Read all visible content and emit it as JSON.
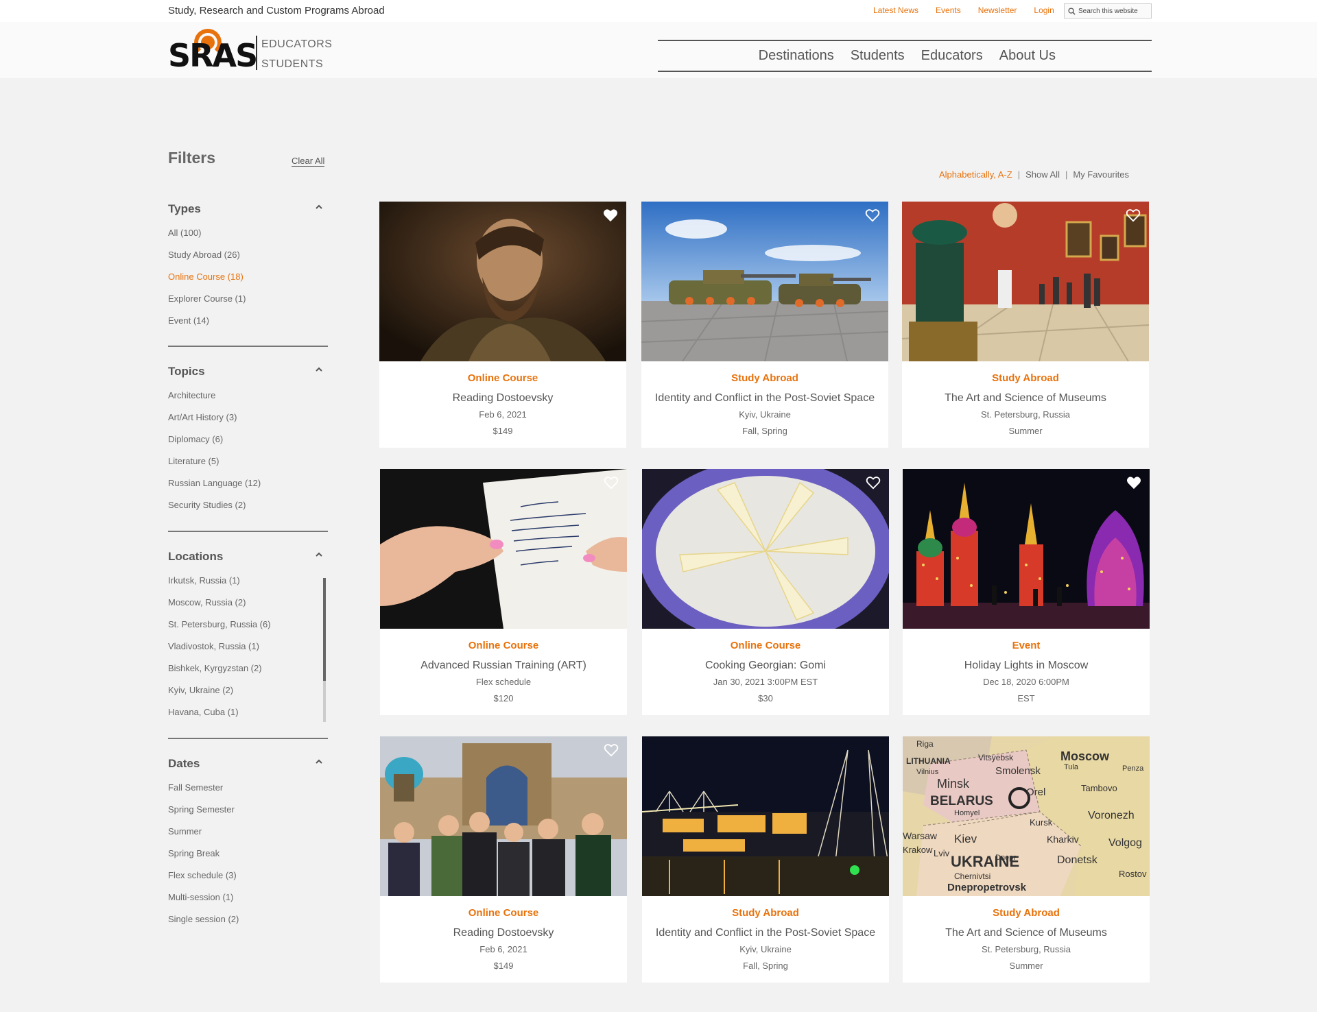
{
  "topbar": {
    "tagline": "Study, Research and Custom Programs Abroad",
    "links": [
      "Latest News",
      "Events",
      "Newsletter",
      "Login"
    ],
    "search_placeholder": "Search this website"
  },
  "header": {
    "logo_text": "SRAS",
    "logo_sub1": "EDUCATORS",
    "logo_sub2": "STUDENTS",
    "nav": [
      "Destinations",
      "Students",
      "Educators",
      "About Us"
    ]
  },
  "filters": {
    "title": "Filters",
    "clear_all": "Clear All",
    "types": {
      "title": "Types",
      "items": [
        "All (100)",
        "Study Abroad (26)",
        "Online Course (18)",
        "Explorer Course (1)",
        "Event (14)"
      ]
    },
    "topics": {
      "title": "Topics",
      "items": [
        "Architecture",
        "Art/Art History (3)",
        "Diplomacy (6)",
        "Literature (5)",
        "Russian Language (12)",
        "Security Studies (2)"
      ]
    },
    "locations": {
      "title": "Locations",
      "items": [
        "Irkutsk, Russia (1)",
        "Moscow, Russia (2)",
        "St. Petersburg, Russia (6)",
        "Vladivostok, Russia (1)",
        "Bishkek, Kyrgyzstan (2)",
        "Kyiv, Ukraine (2)",
        "Havana, Cuba (1)"
      ]
    },
    "dates": {
      "title": "Dates",
      "items": [
        "Fall Semester",
        "Spring Semester",
        "Summer",
        "Spring Break",
        "Flex schedule (3)",
        "Multi-session (1)",
        "Single session (2)"
      ]
    }
  },
  "sort": {
    "active": "Alphabetically, A-Z",
    "show_all": "Show All",
    "favourites": "My Favourites",
    "separator": "|"
  },
  "cards": [
    {
      "type": "Online Course",
      "title": "Reading Dostoevsky",
      "line1": "Feb 6, 2021",
      "line2": "$149",
      "image": "portrait-painting",
      "favourited": true
    },
    {
      "type": "Study Abroad",
      "title": "Identity and Conflict in the Post-Soviet Space",
      "line1": "Kyiv, Ukraine",
      "line2": "Fall, Spring",
      "image": "tanks-square",
      "favourited": false
    },
    {
      "type": "Study Abroad",
      "title": "The Art and Science of Museums",
      "line1": "St. Petersburg, Russia",
      "line2": "Summer",
      "image": "museum-hall",
      "favourited": false
    },
    {
      "type": "Online Course",
      "title": "Advanced Russian Training (ART)",
      "line1": "Flex schedule",
      "line2": "$120",
      "image": "handwritten-note",
      "favourited": false
    },
    {
      "type": "Online Course",
      "title": "Cooking Georgian: Gomi",
      "line1": "Jan 30, 2021 3:00PM EST",
      "line2": "$30",
      "image": "gomi-dish",
      "favourited": false
    },
    {
      "type": "Event",
      "title": "Holiday Lights in Moscow",
      "line1": "Dec 18, 2020 6:00PM",
      "line2": "EST",
      "image": "moscow-lights",
      "favourited": true
    },
    {
      "type": "Online Course",
      "title": "Reading Dostoevsky",
      "line1": "Feb 6, 2021",
      "line2": "$149",
      "image": "group-photo",
      "favourited": false
    },
    {
      "type": "Study Abroad",
      "title": "Identity and Conflict in the Post-Soviet Space",
      "line1": "Kyiv, Ukraine",
      "line2": "Fall, Spring",
      "image": "night-bridge",
      "favourited": false
    },
    {
      "type": "Study Abroad",
      "title": "The Art and Science of Museums",
      "line1": "St. Petersburg, Russia",
      "line2": "Summer",
      "image": "map",
      "favourited": false
    }
  ],
  "map_labels": [
    "LITHUANIA",
    "Vilnius",
    "Minsk",
    "Moscow",
    "Smolensk",
    "BELARUS",
    "Orel",
    "Tambovo",
    "Kursk",
    "Voronezh",
    "Kiev",
    "Kharkiv",
    "UKRAINE",
    "Donetsk",
    "Volgog",
    "Chernivtsi",
    "Dnepropetrovsk",
    "Rostov",
    "Homyel",
    "Penza",
    "Tula",
    "Riga",
    "Vitsyebsk",
    "Dnepr",
    "Lviv",
    "Warsaw",
    "Krakow"
  ],
  "colors": {
    "accent": "#e8720c",
    "text": "#555555",
    "background": "#f2f2f2"
  }
}
